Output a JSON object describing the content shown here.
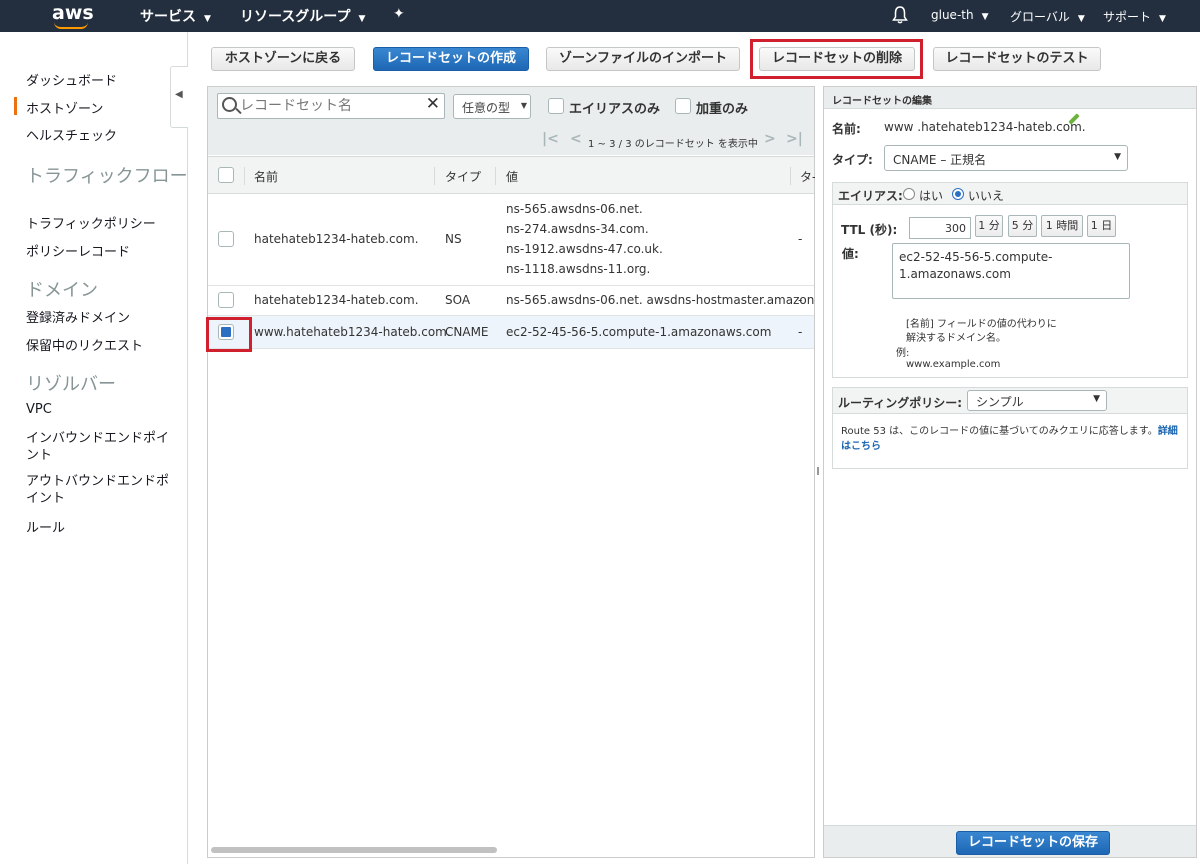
{
  "topnav": {
    "logo": "aws",
    "services": "サービス",
    "resource_groups": "リソースグループ",
    "pin_icon": "pin-icon",
    "bell_icon": "bell-icon",
    "user": "glue-th",
    "region": "グローバル",
    "support": "サポート"
  },
  "sidebar": {
    "items": [
      {
        "label": "ダッシュボード"
      },
      {
        "label": "ホストゾーン",
        "active": true
      },
      {
        "label": "ヘルスチェック"
      }
    ],
    "traffic_heading": "トラフィックフロー",
    "traffic_items": [
      {
        "label": "トラフィックポリシー"
      },
      {
        "label": "ポリシーレコード"
      }
    ],
    "domain_heading": "ドメイン",
    "domain_items": [
      {
        "label": "登録済みドメイン"
      },
      {
        "label": "保留中のリクエスト"
      }
    ],
    "resolver_heading": "リゾルバー",
    "resolver_items": [
      {
        "label": "VPC"
      },
      {
        "label": "インバウンドエンドポイント"
      },
      {
        "label": "アウトバウンドエンドポイント"
      },
      {
        "label": "ルール"
      }
    ],
    "accent_color": "#ec7211"
  },
  "toolbar": {
    "back": "ホストゾーンに戻る",
    "create": "レコードセットの作成",
    "import": "ゾーンファイルのインポート",
    "delete": "レコードセットの削除",
    "test": "レコードセットのテスト"
  },
  "filters": {
    "search_placeholder": "レコードセット名",
    "type_select": "任意の型",
    "alias_only": "エイリアスのみ",
    "weighted_only": "加重のみ",
    "pager_text": "1 ~ 3 / 3 のレコードセット を表示中"
  },
  "table": {
    "columns": [
      "名前",
      "タイプ",
      "値",
      "タ-"
    ],
    "rows": [
      {
        "name": "hatehateb1234-hateb.com.",
        "type": "NS",
        "values": [
          "ns-565.awsdns-06.net.",
          "ns-274.awsdns-34.com.",
          "ns-1912.awsdns-47.co.uk.",
          "ns-1118.awsdns-11.org."
        ],
        "extra": "-",
        "selected": false
      },
      {
        "name": "hatehateb1234-hateb.com.",
        "type": "SOA",
        "values": [
          "ns-565.awsdns-06.net. awsdns-hostmaster.amazon."
        ],
        "extra": "-",
        "selected": false
      },
      {
        "name": "www.hatehateb1234-hateb.com.",
        "type": "CNAME",
        "values": [
          "ec2-52-45-56-5.compute-1.amazonaws.com"
        ],
        "extra": "-",
        "selected": true
      }
    ]
  },
  "edit": {
    "header": "レコードセットの編集",
    "name_label": "名前:",
    "name_value": "www .hatehateb1234-hateb.com.",
    "type_label": "タイプ:",
    "type_value": "CNAME – 正規名",
    "alias_label": "エイリアス:",
    "alias_yes": "はい",
    "alias_no": "いいえ",
    "alias_selected": "いいえ",
    "ttl_label": "TTL (秒):",
    "ttl_value": "300",
    "ttl_buttons": [
      "1 分",
      "5 分",
      "1 時間",
      "1 日"
    ],
    "value_label": "値:",
    "value_text": "ec2-52-45-56-5.compute-\n1.amazonaws.com",
    "hint_line1": "[名前] フィールドの値の代わりに",
    "hint_line2": "解決するドメイン名。",
    "example_label": "例:",
    "example_value": "www.example.com",
    "routing_label": "ルーティングポリシー:",
    "routing_value": "シンプル",
    "routing_desc": "Route 53 は、このレコードの値に基づいてのみクエリに応答します。",
    "routing_link": "詳細はこちら",
    "save": "レコードセットの保存"
  },
  "colors": {
    "nav_bg": "#232f3e",
    "primary": "#1d67b4",
    "highlight": "#d0202d"
  }
}
